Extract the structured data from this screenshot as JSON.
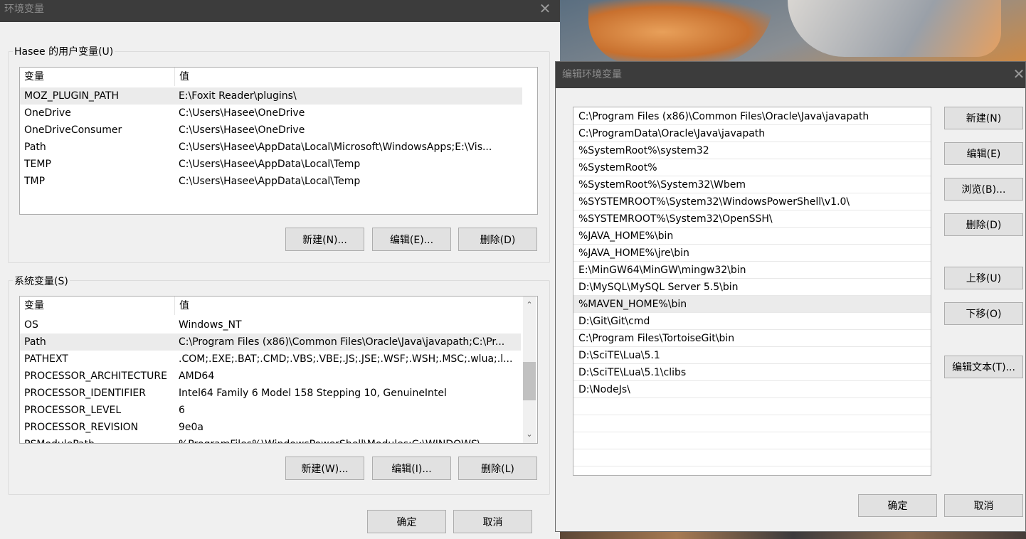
{
  "main_dialog": {
    "title": "环境变量",
    "close_glyph": "✕",
    "user_group_label": "Hasee 的用户变量(U)",
    "system_group_label": "系统变量(S)",
    "col_variable": "变量",
    "col_value": "值",
    "user_vars": [
      {
        "name": "MOZ_PLUGIN_PATH",
        "value": "E:\\Foxit Reader\\plugins\\"
      },
      {
        "name": "OneDrive",
        "value": "C:\\Users\\Hasee\\OneDrive"
      },
      {
        "name": "OneDriveConsumer",
        "value": "C:\\Users\\Hasee\\OneDrive"
      },
      {
        "name": "Path",
        "value": "C:\\Users\\Hasee\\AppData\\Local\\Microsoft\\WindowsApps;E:\\Vis..."
      },
      {
        "name": "TEMP",
        "value": "C:\\Users\\Hasee\\AppData\\Local\\Temp"
      },
      {
        "name": "TMP",
        "value": "C:\\Users\\Hasee\\AppData\\Local\\Temp"
      }
    ],
    "system_vars": [
      {
        "name": "OS",
        "value": "Windows_NT"
      },
      {
        "name": "Path",
        "value": "C:\\Program Files (x86)\\Common Files\\Oracle\\Java\\javapath;C:\\Pr..."
      },
      {
        "name": "PATHEXT",
        "value": ".COM;.EXE;.BAT;.CMD;.VBS;.VBE;.JS;.JSE;.WSF;.WSH;.MSC;.wlua;.l..."
      },
      {
        "name": "PROCESSOR_ARCHITECTURE",
        "value": "AMD64"
      },
      {
        "name": "PROCESSOR_IDENTIFIER",
        "value": "Intel64 Family 6 Model 158 Stepping 10, GenuineIntel"
      },
      {
        "name": "PROCESSOR_LEVEL",
        "value": "6"
      },
      {
        "name": "PROCESSOR_REVISION",
        "value": "9e0a"
      },
      {
        "name": "PSModulePath",
        "value": "%ProgramFiles%\\WindowsPowerShell\\Modules;C:\\WINDOWS\\..."
      }
    ],
    "user_buttons": {
      "new": "新建(N)...",
      "edit": "编辑(E)...",
      "delete": "删除(D)"
    },
    "system_buttons": {
      "new": "新建(W)...",
      "edit": "编辑(I)...",
      "delete": "删除(L)"
    },
    "ok": "确定",
    "cancel": "取消",
    "scroll_up": "⌃",
    "scroll_down": "⌄"
  },
  "edit_dialog": {
    "title": "编辑环境变量",
    "close_glyph": "✕",
    "paths": [
      "C:\\Program Files (x86)\\Common Files\\Oracle\\Java\\javapath",
      "C:\\ProgramData\\Oracle\\Java\\javapath",
      "%SystemRoot%\\system32",
      "%SystemRoot%",
      "%SystemRoot%\\System32\\Wbem",
      "%SYSTEMROOT%\\System32\\WindowsPowerShell\\v1.0\\",
      "%SYSTEMROOT%\\System32\\OpenSSH\\",
      "%JAVA_HOME%\\bin",
      "%JAVA_HOME%\\jre\\bin",
      "E:\\MinGW64\\MinGW\\mingw32\\bin",
      "D:\\MySQL\\MySQL Server 5.5\\bin",
      "%MAVEN_HOME%\\bin",
      "D:\\Git\\Git\\cmd",
      "C:\\Program Files\\TortoiseGit\\bin",
      "D:\\SciTE\\Lua\\5.1",
      "D:\\SciTE\\Lua\\5.1\\clibs",
      "D:\\NodeJs\\",
      "",
      "",
      "",
      ""
    ],
    "selected_index": 11,
    "buttons": {
      "new": "新建(N)",
      "edit": "编辑(E)",
      "browse": "浏览(B)...",
      "delete": "删除(D)",
      "move_up": "上移(U)",
      "move_down": "下移(O)",
      "edit_text": "编辑文本(T)..."
    },
    "ok": "确定",
    "cancel": "取消"
  }
}
